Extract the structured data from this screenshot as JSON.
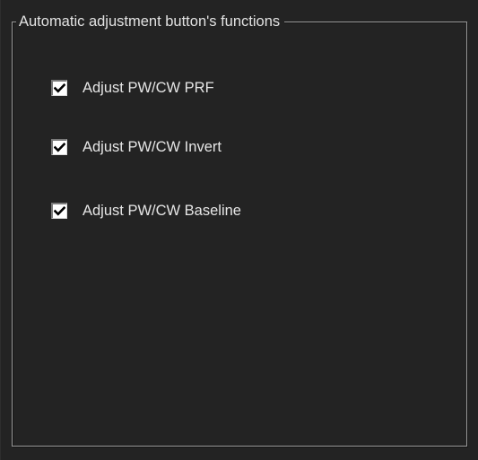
{
  "group": {
    "title": "Automatic adjustment button's functions"
  },
  "options": [
    {
      "label": "Adjust PW/CW PRF",
      "checked": true
    },
    {
      "label": "Adjust PW/CW Invert",
      "checked": true
    },
    {
      "label": "Adjust PW/CW Baseline",
      "checked": true
    }
  ],
  "colors": {
    "background": "#232323",
    "text": "#e6e6e6",
    "group_border": "#9a9a9a"
  },
  "icons": {
    "check": "checkmark-icon"
  }
}
